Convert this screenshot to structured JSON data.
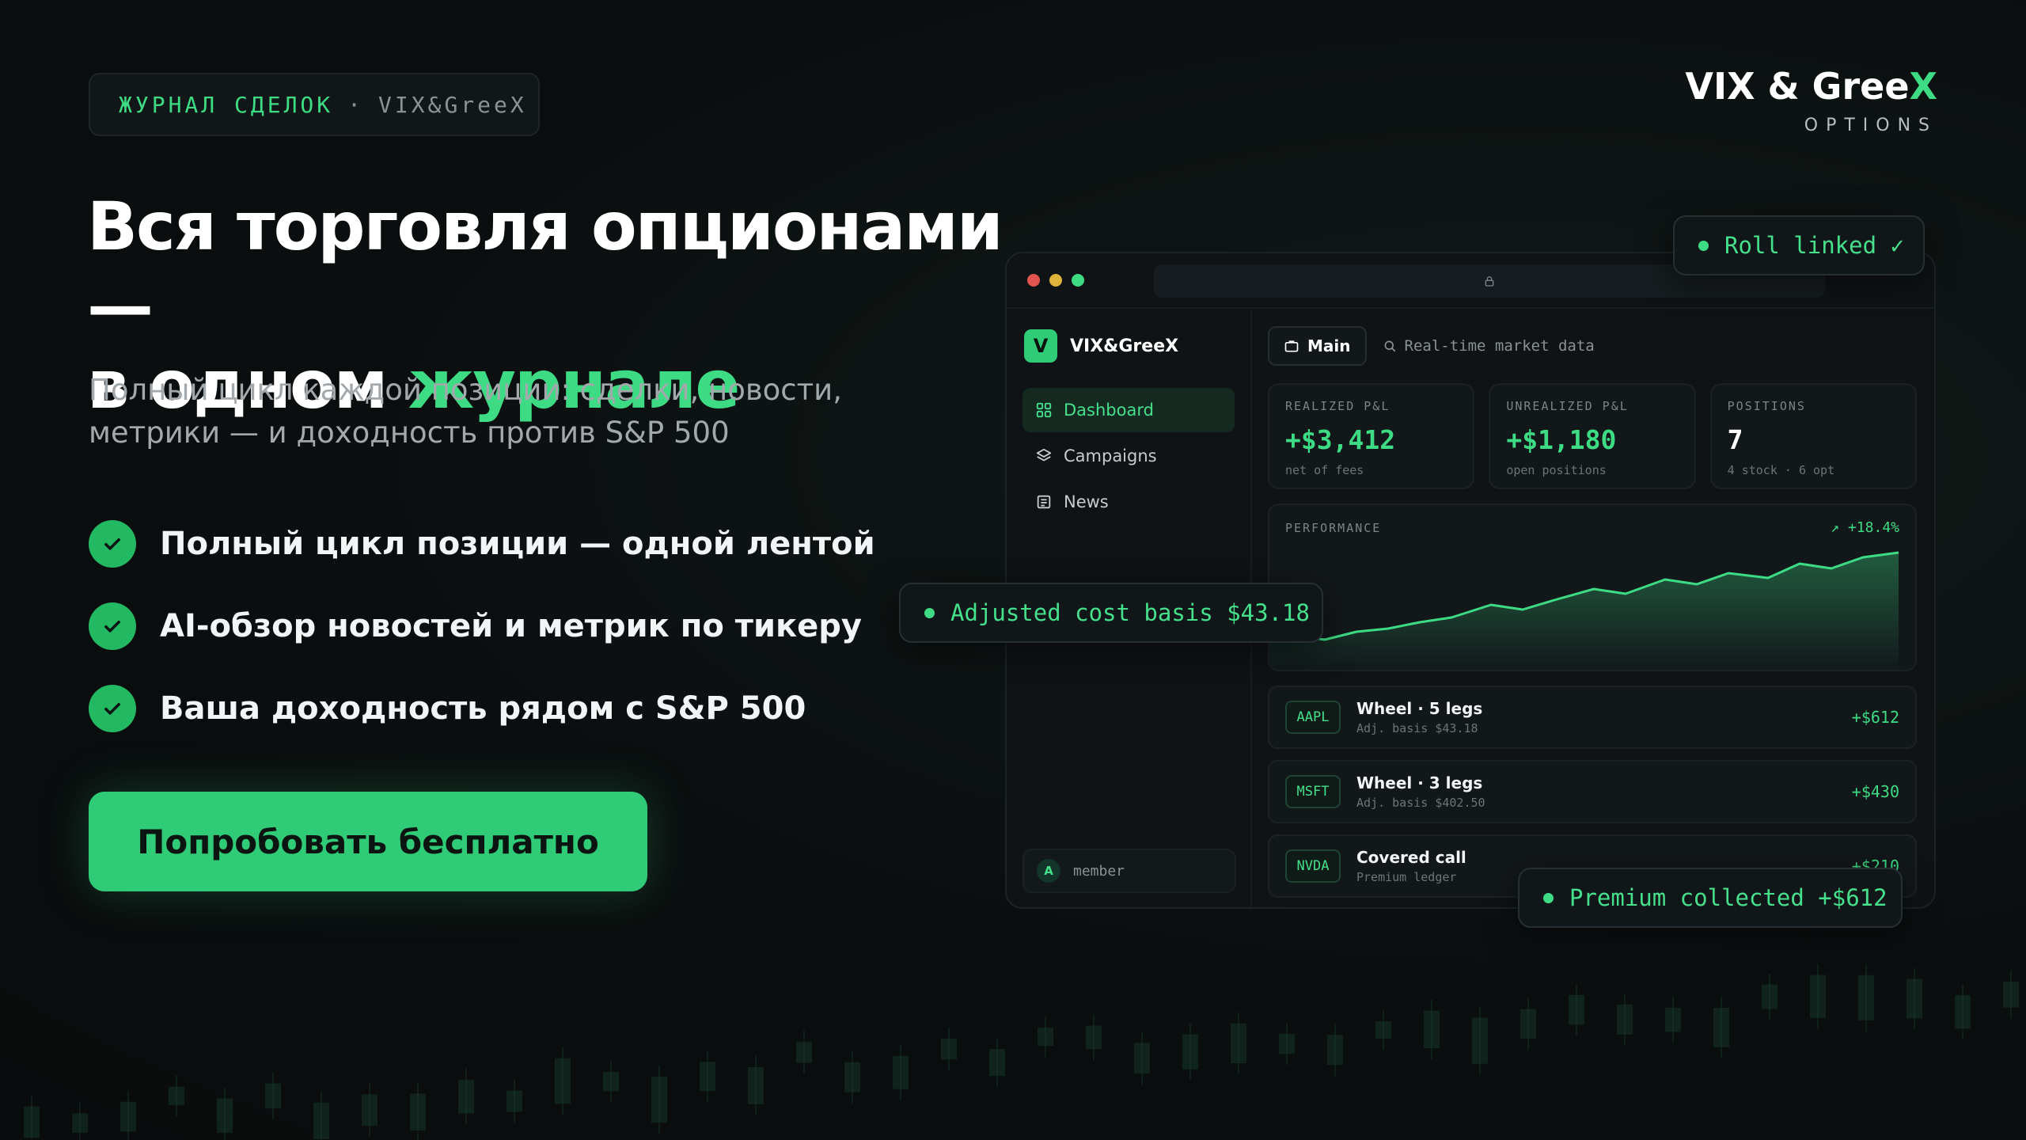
{
  "tag": {
    "part1": "ЖУРНАЛ СДЕЛОК",
    "separator": "·",
    "part2": "VIX&GreeX"
  },
  "brand": {
    "name_main": "VIX & Gree",
    "name_accent": "X",
    "subtitle": "OPTIONS"
  },
  "headline": {
    "line1": "Вся торговля опционами —",
    "line2_prefix": "в одном ",
    "line2_accent": "журнале"
  },
  "subtitle": "Полный цикл каждой позиции: сделки, новости, метрики — и доходность против S&P 500",
  "bullets": [
    "Полный цикл позиции — одной лентой",
    "AI-обзор новостей и метрик по тикеру",
    "Ваша доходность рядом с S&P 500"
  ],
  "cta": {
    "label": "Попробовать бесплатно"
  },
  "colors": {
    "accent": "#3ddc84",
    "cta": "#2fcb77",
    "background": "#0b0e0f"
  },
  "app": {
    "logo_letter": "V",
    "logo_name": "VIX&GreeX",
    "nav": [
      {
        "label": "Dashboard",
        "icon": "grid-icon",
        "active": true
      },
      {
        "label": "Campaigns",
        "icon": "layers-icon",
        "active": false
      },
      {
        "label": "News",
        "icon": "newspaper-icon",
        "active": false
      }
    ],
    "member": {
      "initial": "A",
      "label": "member"
    },
    "topbar": {
      "main_label": "Main",
      "search_placeholder": "Real-time market data"
    },
    "cards": [
      {
        "label": "REALIZED P&L",
        "value": "+$3,412",
        "note": "net of fees"
      },
      {
        "label": "UNREALIZED P&L",
        "value": "+$1,180",
        "note": "open positions"
      },
      {
        "label": "POSITIONS",
        "value": "7",
        "note": "4 stock · 6 opt"
      }
    ],
    "performance": {
      "label": "PERFORMANCE",
      "change": "↗ +18.4%"
    },
    "positions": [
      {
        "ticker": "AAPL",
        "title": "Wheel · 5 legs",
        "sub": "Adj. basis $43.18",
        "pnl": "+$612"
      },
      {
        "ticker": "MSFT",
        "title": "Wheel · 3 legs",
        "sub": "Adj. basis $402.50",
        "pnl": "+$430"
      },
      {
        "ticker": "NVDA",
        "title": "Covered call",
        "sub": "Premium ledger",
        "pnl": "+$210"
      }
    ]
  },
  "pills": {
    "roll": "Roll linked ✓",
    "cost_basis": "Adjusted cost basis $43.18",
    "premium": "Premium collected +$612"
  }
}
